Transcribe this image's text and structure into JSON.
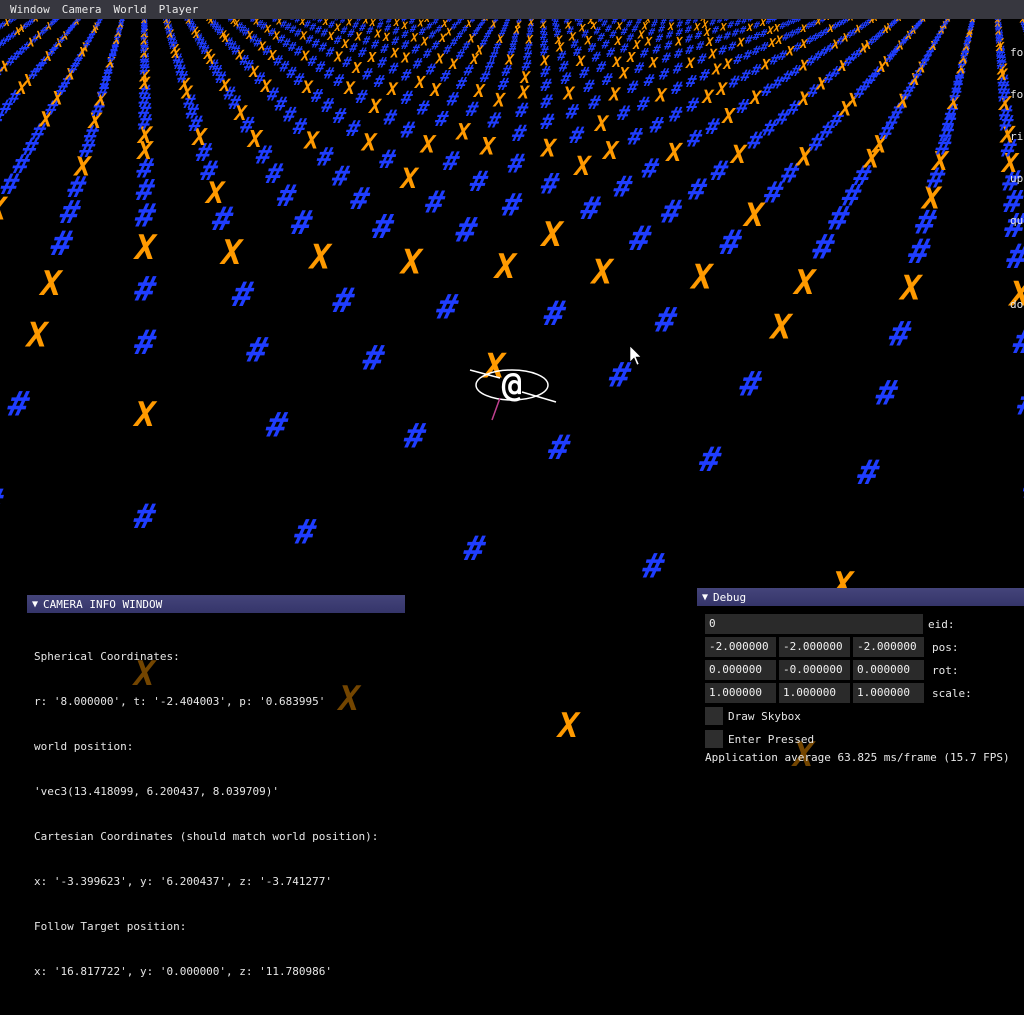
{
  "menubar": {
    "items": [
      {
        "label": "Window"
      },
      {
        "label": "Camera"
      },
      {
        "label": "World"
      },
      {
        "label": "Player"
      }
    ]
  },
  "hud_right": {
    "lines": [
      "fo",
      "fo",
      "ri",
      "up",
      "qu",
      "",
      "do"
    ]
  },
  "scene": {
    "player_glyph": "@",
    "cross_glyph": "X",
    "grid_glyph": "#",
    "colors": {
      "cross": "#ff9a00",
      "hash": "#1f3dff",
      "player": "#ffffff",
      "background": "#000000"
    }
  },
  "camera_window": {
    "title": "CAMERA INFO WINDOW",
    "lines": [
      "Spherical Coordinates:",
      "r: '8.000000', t: '-2.404003', p: '0.683995'",
      "world position:",
      "'vec3(13.418099, 6.200437, 8.039709)'",
      "Cartesian Coordinates (should match world position):",
      "x: '-3.399623', y: '6.200437', z: '-3.741277'",
      "Follow Target position:",
      "x: '16.817722', y: '0.000000', z: '11.780986'"
    ]
  },
  "debug_window": {
    "title": "Debug",
    "eid": {
      "value": "0",
      "label": "eid:"
    },
    "pos": {
      "values": [
        "-2.000000",
        "-2.000000",
        "-2.000000"
      ],
      "label": "pos:"
    },
    "rot": {
      "values": [
        "0.000000",
        "-0.000000",
        "0.000000"
      ],
      "label": "rot:"
    },
    "scale": {
      "values": [
        "1.000000",
        "1.000000",
        "1.000000"
      ],
      "label": "scale:"
    },
    "checkboxes": [
      {
        "label": "Draw Skybox",
        "checked": false
      },
      {
        "label": "Enter Pressed",
        "checked": false
      }
    ],
    "fps_text": "Application average 63.825 ms/frame (15.7 FPS)"
  }
}
